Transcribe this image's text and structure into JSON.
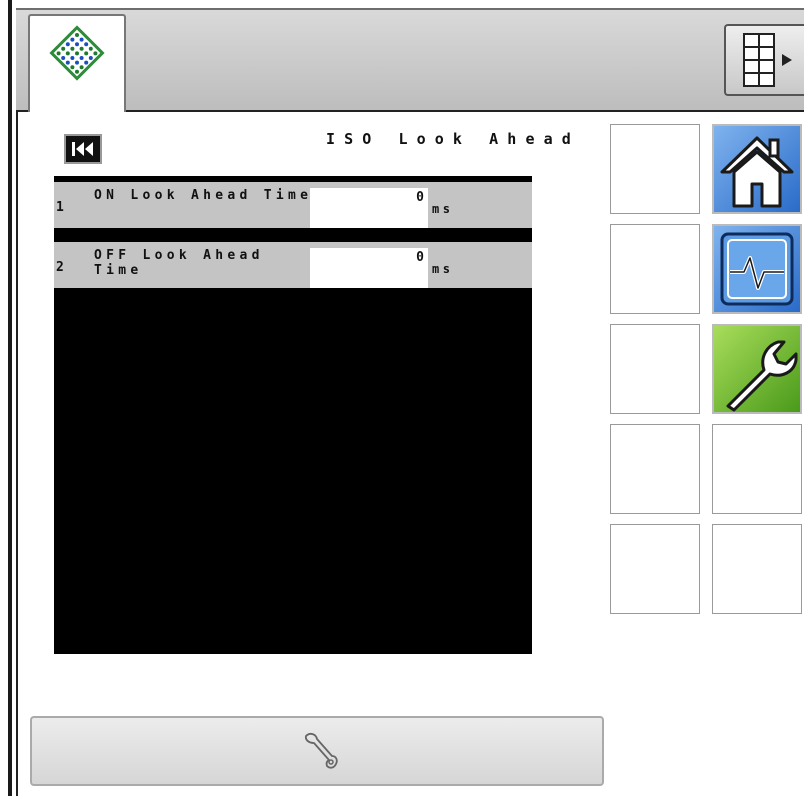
{
  "header": {
    "app_tab_icon": "iso-logo-icon",
    "menu_icon": "grid-menu-icon"
  },
  "page": {
    "title": "ISO Look Ahead",
    "back_icon": "skip-back-icon"
  },
  "parameters": [
    {
      "index": "1",
      "label": "ON Look Ahead Time",
      "value": "0",
      "unit": "ms"
    },
    {
      "index": "2",
      "label": "OFF Look Ahead Time",
      "value": "0",
      "unit": "ms"
    }
  ],
  "soft_keys": {
    "home_icon": "home-icon",
    "diagnostics_icon": "diagnostics-icon",
    "tools_icon": "wrench-icon"
  },
  "bottom_bar": {
    "icon": "wrench-outline-icon"
  },
  "colors": {
    "panel_background": "#000000",
    "row_background": "#c4c4c4",
    "blue_key": "#2a6bc9",
    "green_key": "#4a9a1a"
  }
}
